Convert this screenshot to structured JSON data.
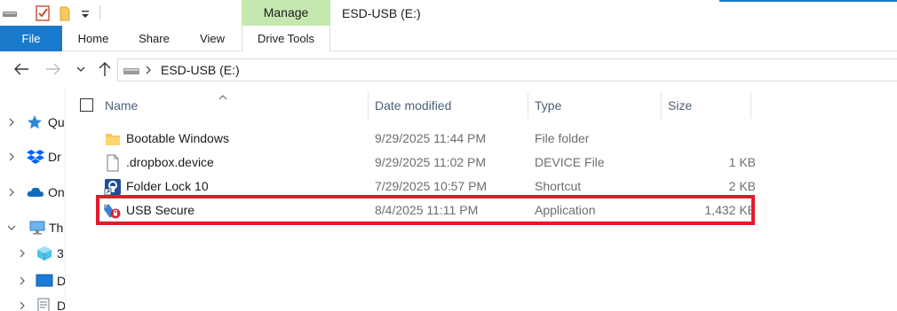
{
  "colors": {
    "accent": "#1979ca",
    "manage_tab_bg": "#c5e8b0",
    "highlight_outline": "#e21b2c",
    "folder_yellow": "#f6c85e"
  },
  "titlebar": {
    "quick_access_icons": [
      "drive-icon",
      "properties-checkmark-icon",
      "new-folder-icon",
      "customize-dropdown-icon"
    ],
    "context_tab": "Manage",
    "window_title": "ESD-USB (E:)"
  },
  "ribbon": {
    "tabs": [
      {
        "label": "File",
        "active": true
      },
      {
        "label": "Home"
      },
      {
        "label": "Share"
      },
      {
        "label": "View"
      },
      {
        "label": "Drive Tools"
      }
    ]
  },
  "address": {
    "path_icon": "usb-drive-icon",
    "path": "ESD-USB (E:)"
  },
  "navpane": {
    "items": [
      {
        "label": "Qu",
        "icon": "star-icon"
      },
      {
        "label": "Dr",
        "icon": "dropbox-icon"
      },
      {
        "label": "On",
        "icon": "onedrive-cloud-icon"
      },
      {
        "label": "Th",
        "icon": "this-pc-icon"
      },
      {
        "label": "3",
        "icon": "3d-objects-icon"
      },
      {
        "label": "D",
        "icon": "desktop-icon"
      },
      {
        "label": "D",
        "icon": "documents-icon"
      }
    ]
  },
  "filelist": {
    "columns": {
      "name": "Name",
      "date": "Date modified",
      "type": "Type",
      "size": "Size"
    },
    "rows": [
      {
        "name": "Bootable Windows",
        "date": "9/29/2025 11:44 PM",
        "type": "File folder",
        "size": "",
        "icon": "folder-icon"
      },
      {
        "name": ".dropbox.device",
        "date": "9/29/2025 11:02 PM",
        "type": "DEVICE File",
        "size": "1 KB",
        "icon": "file-icon"
      },
      {
        "name": "Folder Lock 10",
        "date": "7/29/2025 10:57 PM",
        "type": "Shortcut",
        "size": "2 KB",
        "icon": "folder-lock-shortcut-icon"
      },
      {
        "name": "USB Secure",
        "date": "8/4/2025 11:11 PM",
        "type": "Application",
        "size": "1,432 KB",
        "icon": "usb-secure-app-icon"
      }
    ]
  }
}
